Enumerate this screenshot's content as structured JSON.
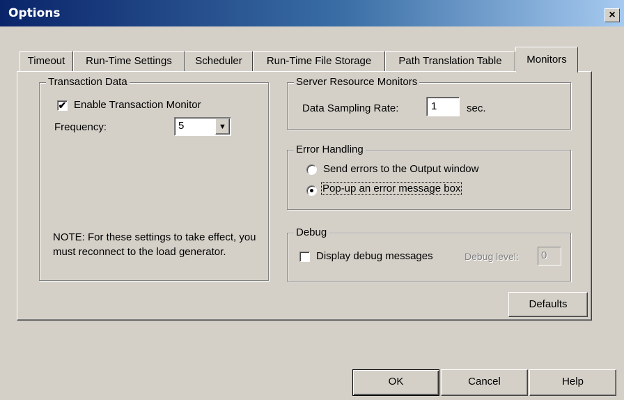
{
  "window": {
    "title": "Options",
    "close_glyph": "×"
  },
  "tabs": [
    {
      "label": "Timeout",
      "active": false
    },
    {
      "label": "Run-Time Settings",
      "active": false
    },
    {
      "label": "Scheduler",
      "active": false
    },
    {
      "label": "Run-Time File Storage",
      "active": false
    },
    {
      "label": "Path Translation Table",
      "active": false
    },
    {
      "label": "Monitors",
      "active": true
    }
  ],
  "transaction_data": {
    "title": "Transaction Data",
    "enable_label": "Enable Transaction Monitor",
    "enable_checked": true,
    "frequency_label": "Frequency:",
    "frequency_value": "5",
    "note": "NOTE: For these settings to take effect, you must reconnect to the load generator."
  },
  "server_resource": {
    "title": "Server Resource Monitors",
    "rate_label": "Data Sampling Rate:",
    "rate_value": "1",
    "rate_unit": "sec."
  },
  "error_handling": {
    "title": "Error Handling",
    "options": [
      {
        "label": "Send errors to the Output window",
        "selected": false
      },
      {
        "label": "Pop-up an error message box",
        "selected": true
      }
    ]
  },
  "debug": {
    "title": "Debug",
    "display_label": "Display debug messages",
    "display_checked": false,
    "level_label": "Debug level:",
    "level_value": "0"
  },
  "buttons": {
    "defaults": "Defaults",
    "ok": "OK",
    "cancel": "Cancel",
    "help": "Help"
  }
}
